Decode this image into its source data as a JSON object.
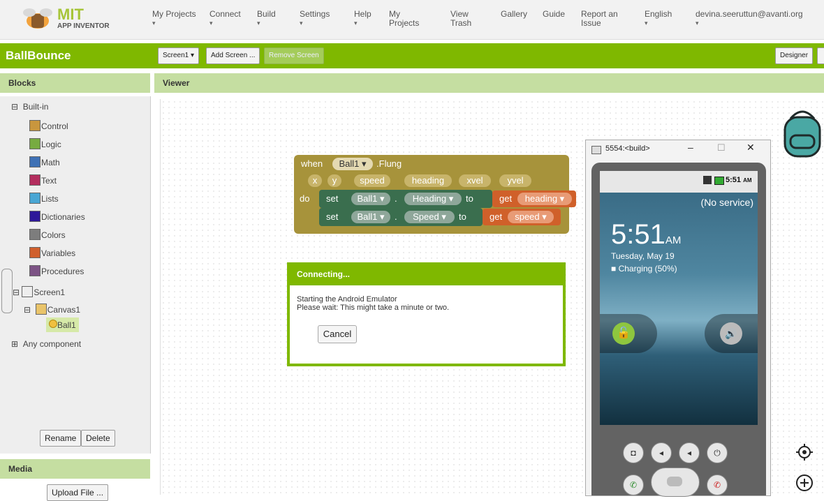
{
  "app": {
    "logo_big": "MIT",
    "logo_small": "APP INVENTOR"
  },
  "nav": [
    {
      "label": "My Projects",
      "dot": "▾"
    },
    {
      "label": "Connect",
      "dot": "▾"
    },
    {
      "label": "Build",
      "dot": "▾"
    },
    {
      "label": "Settings",
      "dot": "▾"
    },
    {
      "label": "Help",
      "dot": "▾"
    },
    {
      "label": "My\nProjects",
      "dot": ""
    },
    {
      "label": "View\nTrash",
      "dot": ""
    },
    {
      "label": "Gallery",
      "dot": ""
    },
    {
      "label": "Guide",
      "dot": ""
    },
    {
      "label": "Report an\nIssue",
      "dot": ""
    },
    {
      "label": "English",
      "dot": "▾"
    },
    {
      "label": "devina.seeruttun@avanti.org",
      "dot": "▾"
    }
  ],
  "project": {
    "name": "BallBounce",
    "screen_select": "Screen1 ▾",
    "add_screen": "Add Screen ...",
    "remove_screen": "Remove Screen",
    "designer": "Designer"
  },
  "panels": {
    "blocks": "Blocks",
    "viewer": "Viewer",
    "media": "Media"
  },
  "tree": {
    "builtin": "Built-in",
    "items": [
      {
        "label": "Control",
        "color": "#c8963e"
      },
      {
        "label": "Logic",
        "color": "#77ab41"
      },
      {
        "label": "Math",
        "color": "#3f71b5"
      },
      {
        "label": "Text",
        "color": "#b32d5e"
      },
      {
        "label": "Lists",
        "color": "#49a6d4"
      },
      {
        "label": "Dictionaries",
        "color": "#2d1799"
      },
      {
        "label": "Colors",
        "color": "#7d7d7d"
      },
      {
        "label": "Variables",
        "color": "#d05f2d"
      },
      {
        "label": "Procedures",
        "color": "#7c5385"
      }
    ],
    "screen": "Screen1",
    "canvas": "Canvas1",
    "ball": "Ball1",
    "any": "Any component"
  },
  "buttons": {
    "rename": "Rename",
    "delete": "Delete",
    "upload": "Upload File ..."
  },
  "block": {
    "when": "when",
    "comp": "Ball1",
    "event": "Flung",
    "params": [
      "x",
      "y",
      "speed",
      "heading",
      "xvel",
      "yvel"
    ],
    "do": "do",
    "set": "set",
    "to": "to",
    "get": "get",
    "row1_prop": "Heading",
    "row1_var": "heading",
    "row2_prop": "Speed",
    "row2_var": "speed"
  },
  "dialog": {
    "title": "Connecting...",
    "line1": "Starting the Android Emulator",
    "line2": "Please wait: This might take a minute or two.",
    "cancel": "Cancel"
  },
  "emulator": {
    "title": "5554:<build>",
    "clock_status": "5:51",
    "ampm_status": "AM",
    "service": "(No service)",
    "time": "5:51",
    "ampm": "AM",
    "date": "Tuesday, May 19",
    "charging": "Charging (50%)"
  }
}
